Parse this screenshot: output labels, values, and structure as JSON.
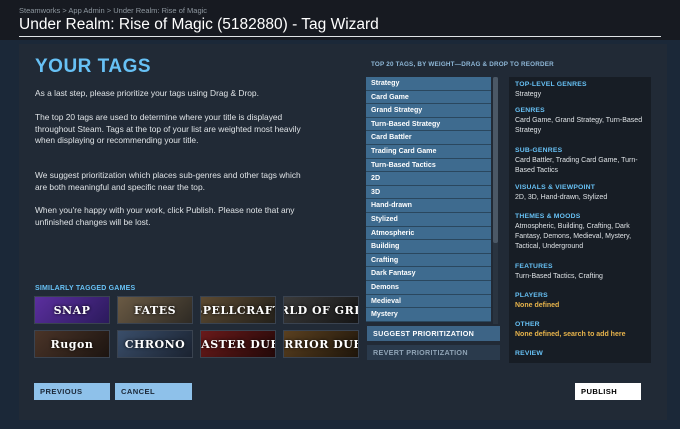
{
  "breadcrumb": {
    "items": [
      "Steamworks",
      "App Admin",
      "Under Realm: Rise of Magic"
    ],
    "separator": " > "
  },
  "page_title": "Under Realm: Rise of Magic (5182880) - Tag Wizard",
  "intro": {
    "heading": "YOUR TAGS",
    "paragraphs": [
      "As a last step, please prioritize your tags using Drag & Drop.",
      "The top 20 tags are used to determine where your title is displayed throughout Steam. Tags at the top of your list are weighted most heavily when displaying or recommending your title.",
      "We suggest prioritization which places sub-genres and other tags which are both meaningful and specific near the top.",
      "When you're happy with your work, click Publish. Please note that any unfinished changes will be lost."
    ]
  },
  "similar_games": {
    "label": "SIMILARLY TAGGED GAMES",
    "games": [
      {
        "name": "SNAP",
        "color": "#5b2f9e",
        "color2": "#2b1a5c"
      },
      {
        "name": "FATES",
        "color": "#6a5a44",
        "color2": "#2e2a24"
      },
      {
        "name": "SPELLCRAFT",
        "color": "#5c4a32",
        "color2": "#23201a"
      },
      {
        "name": "WORLD OF GRIMM",
        "color": "#3a3a3a",
        "color2": "#151515"
      },
      {
        "name": "Rugon",
        "color": "#4a3428",
        "color2": "#1c1410"
      },
      {
        "name": "CHRONO",
        "color": "#3a4e6a",
        "color2": "#1a2230"
      },
      {
        "name": "MASTER DUEL",
        "color": "#6a1a1a",
        "color2": "#220808"
      },
      {
        "name": "WARRIOR DUELS",
        "color": "#5a4020",
        "color2": "#1e150a"
      }
    ]
  },
  "tag_list": {
    "label": "TOP 20 TAGS, BY WEIGHT—DRAG & DROP TO REORDER",
    "tags": [
      "Strategy",
      "Card Game",
      "Grand Strategy",
      "Turn-Based Strategy",
      "Card Battler",
      "Trading Card Game",
      "Turn-Based Tactics",
      "2D",
      "3D",
      "Hand-drawn",
      "Stylized",
      "Atmospheric",
      "Building",
      "Crafting",
      "Dark Fantasy",
      "Demons",
      "Medieval",
      "Mystery"
    ]
  },
  "actions": {
    "suggest": "SUGGEST PRIORITIZATION",
    "revert": "REVERT PRIORITIZATION",
    "previous": "PREVIOUS",
    "cancel": "CANCEL",
    "publish": "PUBLISH"
  },
  "categories": [
    {
      "title": "TOP-LEVEL GENRES",
      "body": "Strategy",
      "warn": false
    },
    {
      "title": "GENRES",
      "body": "Card Game, Grand Strategy, Turn-Based Strategy",
      "warn": false
    },
    {
      "title": "SUB-GENRES",
      "body": "Card Battler, Trading Card Game, Turn-Based Tactics",
      "warn": false
    },
    {
      "title": "VISUALS & VIEWPOINT",
      "body": "2D, 3D, Hand-drawn, Stylized",
      "warn": false
    },
    {
      "title": "THEMES & MOODS",
      "body": "Atmospheric, Building, Crafting, Dark Fantasy, Demons, Medieval, Mystery, Tactical, Underground",
      "warn": false
    },
    {
      "title": "FEATURES",
      "body": "Turn-Based Tactics, Crafting",
      "warn": false
    },
    {
      "title": "PLAYERS",
      "body": "None defined",
      "warn": true
    },
    {
      "title": "OTHER",
      "body": "None defined, search to add here",
      "warn": true
    },
    {
      "title": "REVIEW",
      "body": "",
      "warn": false
    }
  ]
}
